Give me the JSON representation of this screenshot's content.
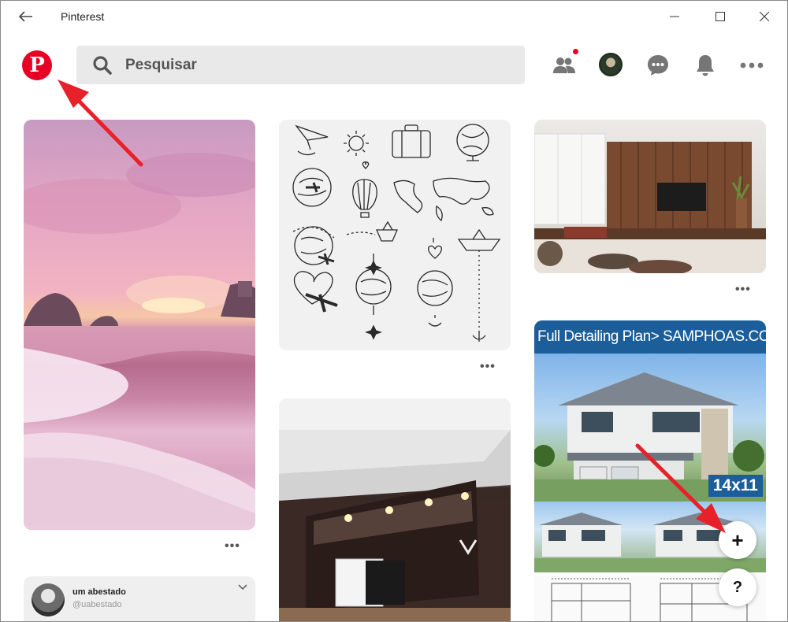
{
  "window": {
    "title": "Pinterest"
  },
  "header": {
    "logo_letter": "P",
    "search_placeholder": "Pesquisar"
  },
  "pins": {
    "house_banner": "Full Detailing Plan> SAMPHOAS.COM",
    "house_tag": "14x11",
    "more_label": "•••"
  },
  "user_card": {
    "name": "um abestado",
    "handle": "@uabestado"
  },
  "fab": {
    "add_label": "+",
    "help_label": "?"
  },
  "colors": {
    "brand": "#e60023",
    "annotation_arrow": "#e8202a",
    "search_bg": "#e9e9e9"
  }
}
